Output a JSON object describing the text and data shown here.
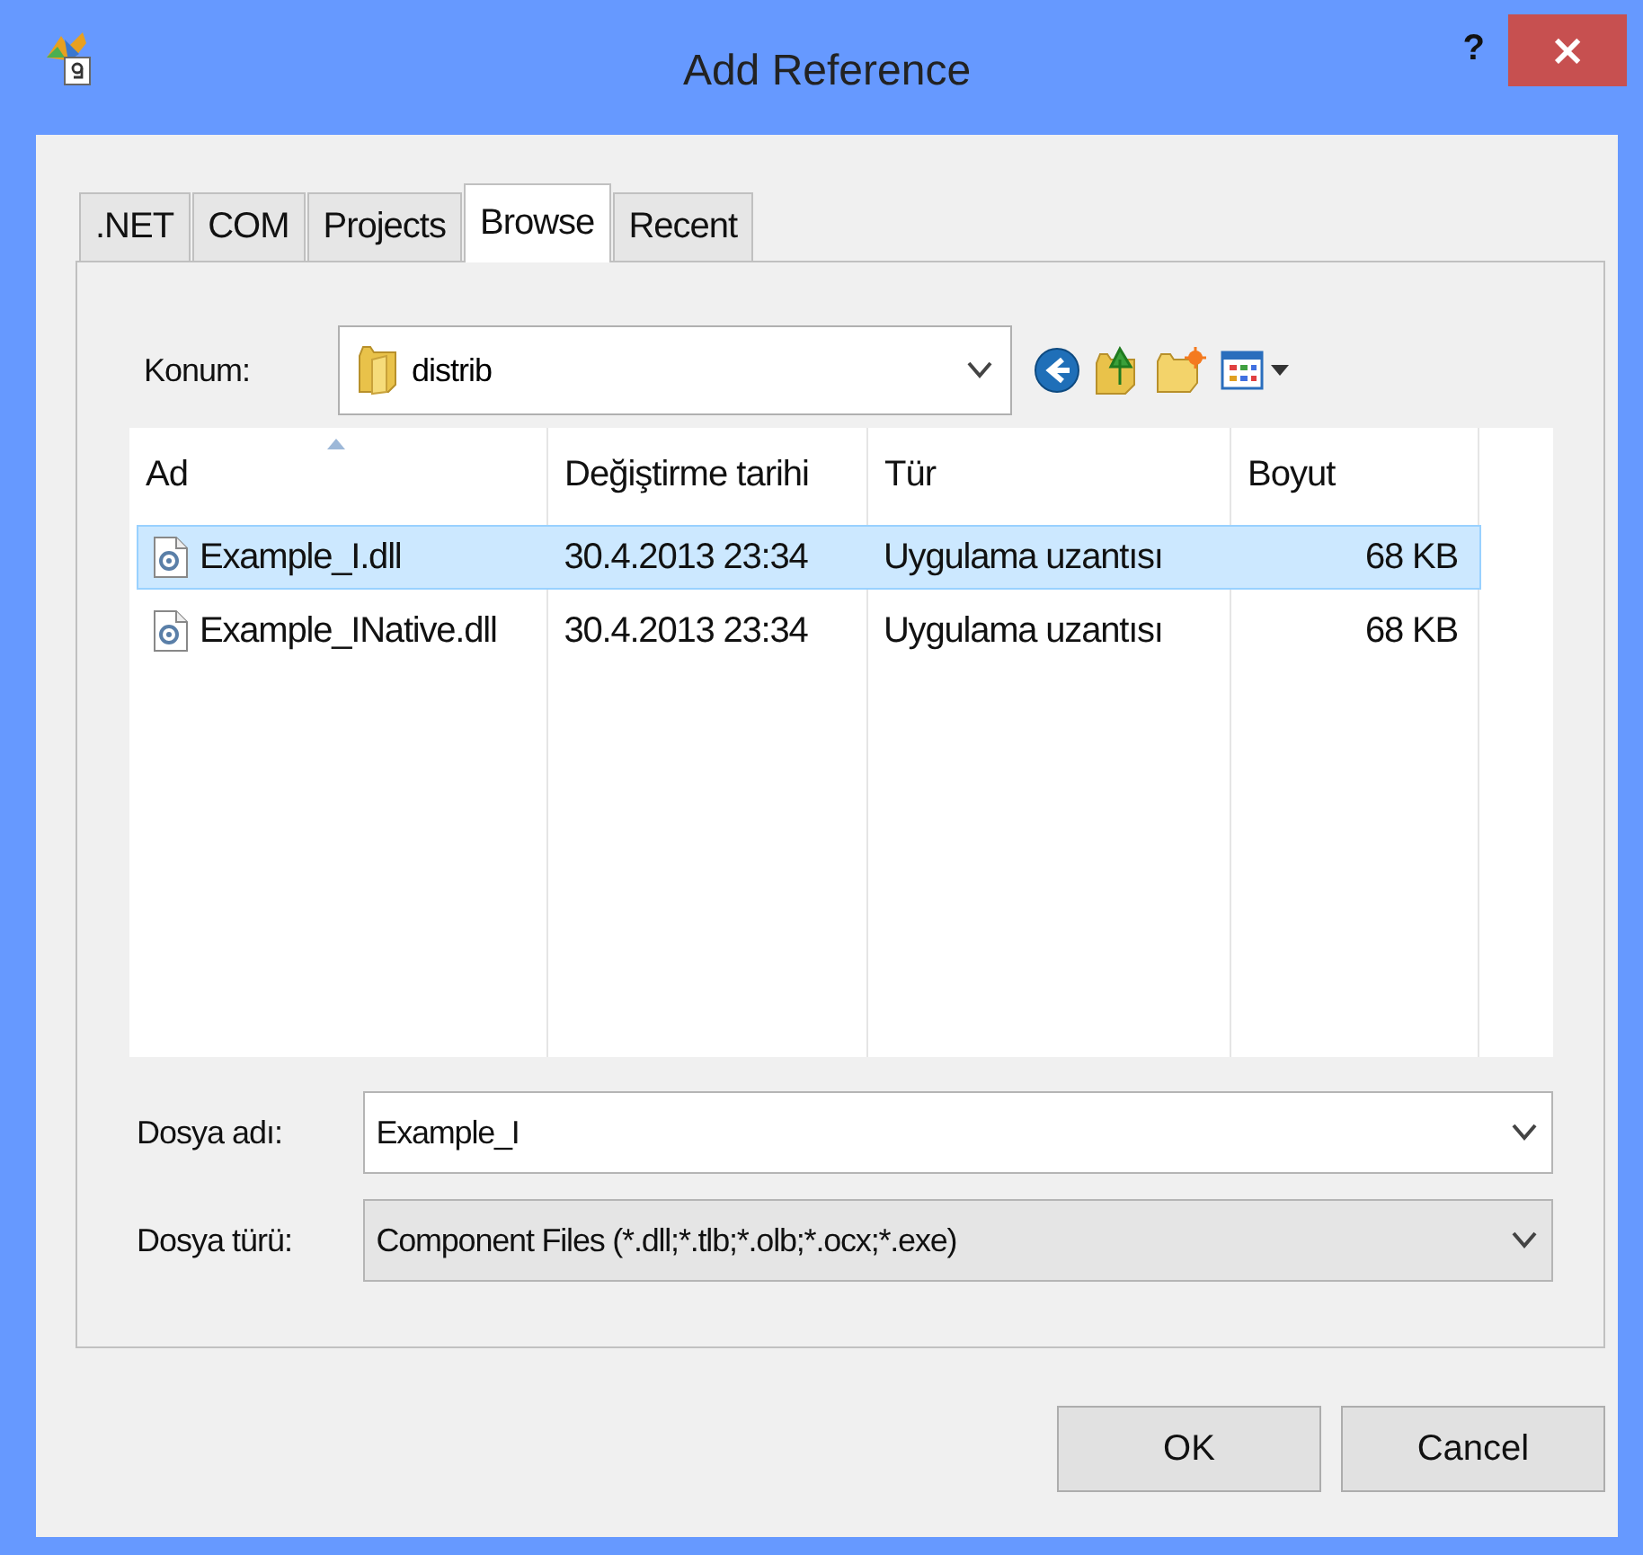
{
  "window": {
    "title": "Add Reference",
    "help": "?",
    "close": "×"
  },
  "tabs": [
    {
      "label": ".NET",
      "selected": false
    },
    {
      "label": "COM",
      "selected": false
    },
    {
      "label": "Projects",
      "selected": false
    },
    {
      "label": "Browse",
      "selected": true
    },
    {
      "label": "Recent",
      "selected": false
    }
  ],
  "location": {
    "label": "Konum:",
    "value": "distrib"
  },
  "table": {
    "columns": [
      {
        "label": "Ad",
        "sorted": true
      },
      {
        "label": "Değiştirme tarihi",
        "sorted": false
      },
      {
        "label": "Tür",
        "sorted": false
      },
      {
        "label": "Boyut",
        "sorted": false
      }
    ],
    "rows": [
      {
        "cells": [
          "Example_I.dll",
          "30.4.2013 23:34",
          "Uygulama uzantısı",
          "68 KB"
        ],
        "selected": true
      },
      {
        "cells": [
          "Example_INative.dll",
          "30.4.2013 23:34",
          "Uygulama uzantısı",
          "68 KB"
        ],
        "selected": false
      }
    ]
  },
  "file_name": {
    "label": "Dosya adı:",
    "value": "Example_I"
  },
  "file_type": {
    "label": "Dosya türü:",
    "value": "Component Files (*.dll;*.tlb;*.olb;*.ocx;*.exe)"
  },
  "buttons": [
    "OK",
    "Cancel"
  ]
}
